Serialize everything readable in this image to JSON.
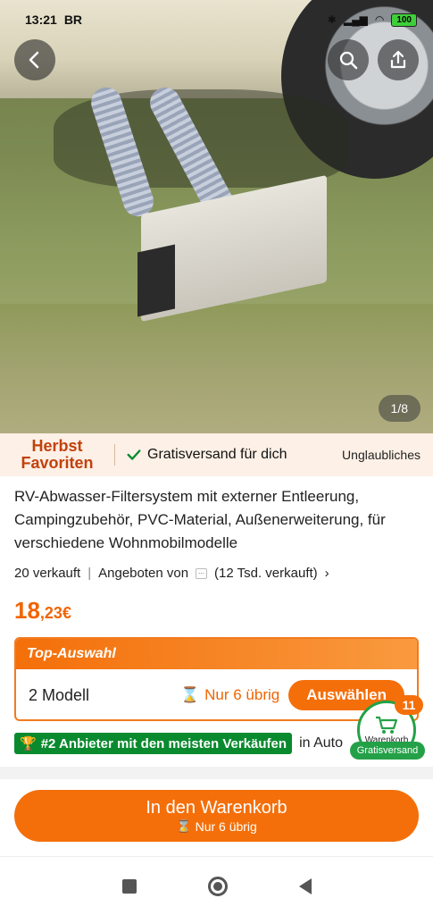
{
  "status_bar": {
    "time": "13:21",
    "carrier_icon": "BR",
    "battery": "100"
  },
  "hero": {
    "image_alt": "product-photo",
    "pager": "1/8"
  },
  "promo": {
    "badge_line1": "Herbst",
    "badge_line2": "Favoriten",
    "shipping": "Gratisversand für dich",
    "right_text": "Unglaubliches"
  },
  "product": {
    "title": "RV-Abwasser-Filtersystem mit externer Entleerung, Campingzubehör, PVC-Material, Außenerweiterung, für verschiedene Wohnmobilmodelle",
    "sold": "20 verkauft",
    "offered_by": "Angeboten von",
    "seller_sales": "(12 Tsd. verkauft)",
    "price_int": "18",
    "price_frac": ",23€"
  },
  "selection": {
    "header": "Top-Auswahl",
    "model": "2 Modell",
    "stock": "Nur 6 übrig",
    "choose": "Auswählen"
  },
  "rank": {
    "tag": "#2 Anbieter mit den meisten Verkäufen",
    "suffix": "in Auto"
  },
  "cart_float": {
    "count": "11",
    "label": "Warenkorb",
    "free": "Gratisversand"
  },
  "cta": {
    "main": "In den Warenkorb",
    "sub": "Nur 6 übrig"
  },
  "colors": {
    "accent": "#f46f0a",
    "green": "#24a148"
  }
}
